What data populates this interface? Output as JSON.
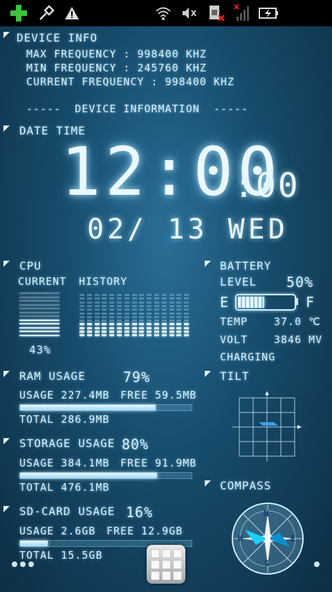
{
  "status_bar": {
    "icons": [
      "add-icon",
      "usb-debug-icon",
      "warning-icon",
      "wifi-icon",
      "mute-icon",
      "no-sim-icon",
      "no-signal-icon",
      "battery-charging-icon"
    ]
  },
  "device_info": {
    "title": "DEVICE INFO",
    "max_freq": "MAX FREQUENCY : 998400 KHZ",
    "min_freq": "MIN FREQUENCY : 245760 KHZ",
    "cur_freq": "CURRENT FREQUENCY : 998400 KHZ",
    "divider": "-----  DEVICE INFORMATION  -----"
  },
  "datetime": {
    "title": "DATE TIME",
    "time": "12:00",
    "seconds": ":00",
    "date": "02/ 13 WED"
  },
  "cpu": {
    "title": "CPU",
    "current_label": "CURRENT",
    "history_label": "HISTORY",
    "percent": "43%",
    "current_value": 0.43,
    "history": [
      0.35,
      0.35,
      0.3,
      0.35,
      0.35,
      0.3,
      0.35,
      0.3,
      0.35,
      0.3,
      0.35,
      0.3,
      0.3,
      0.35,
      0.3
    ]
  },
  "battery": {
    "title": "BATTERY",
    "level_label": "LEVEL",
    "level": "50%",
    "level_value": 0.5,
    "empty": "E",
    "full": "F",
    "temp_label": "TEMP",
    "temp": "37.0 ℃",
    "volt_label": "VOLT",
    "volt": "3846 MV",
    "status": "CHARGING"
  },
  "ram": {
    "title": "RAM USAGE",
    "percent": "79%",
    "usage": "USAGE 227.4MB",
    "free": "FREE 59.5MB",
    "total": "TOTAL 286.9MB",
    "value": 0.79
  },
  "storage": {
    "title": "STORAGE USAGE",
    "percent": "80%",
    "usage": "USAGE 384.1MB",
    "free": "FREE 91.9MB",
    "total": "TOTAL 476.1MB",
    "value": 0.8
  },
  "sdcard": {
    "title": "SD-CARD USAGE",
    "percent": "16%",
    "usage": "USAGE 2.6GB",
    "free": "FREE 12.9GB",
    "total": "TOTAL 15.5GB",
    "value": 0.16
  },
  "tilt": {
    "title": "TILT"
  },
  "compass": {
    "title": "COMPASS",
    "n": "N",
    "s": "S",
    "e": "E",
    "w": "W"
  },
  "colors": {
    "accent": "#bfeaff",
    "background": "#174b6b"
  }
}
